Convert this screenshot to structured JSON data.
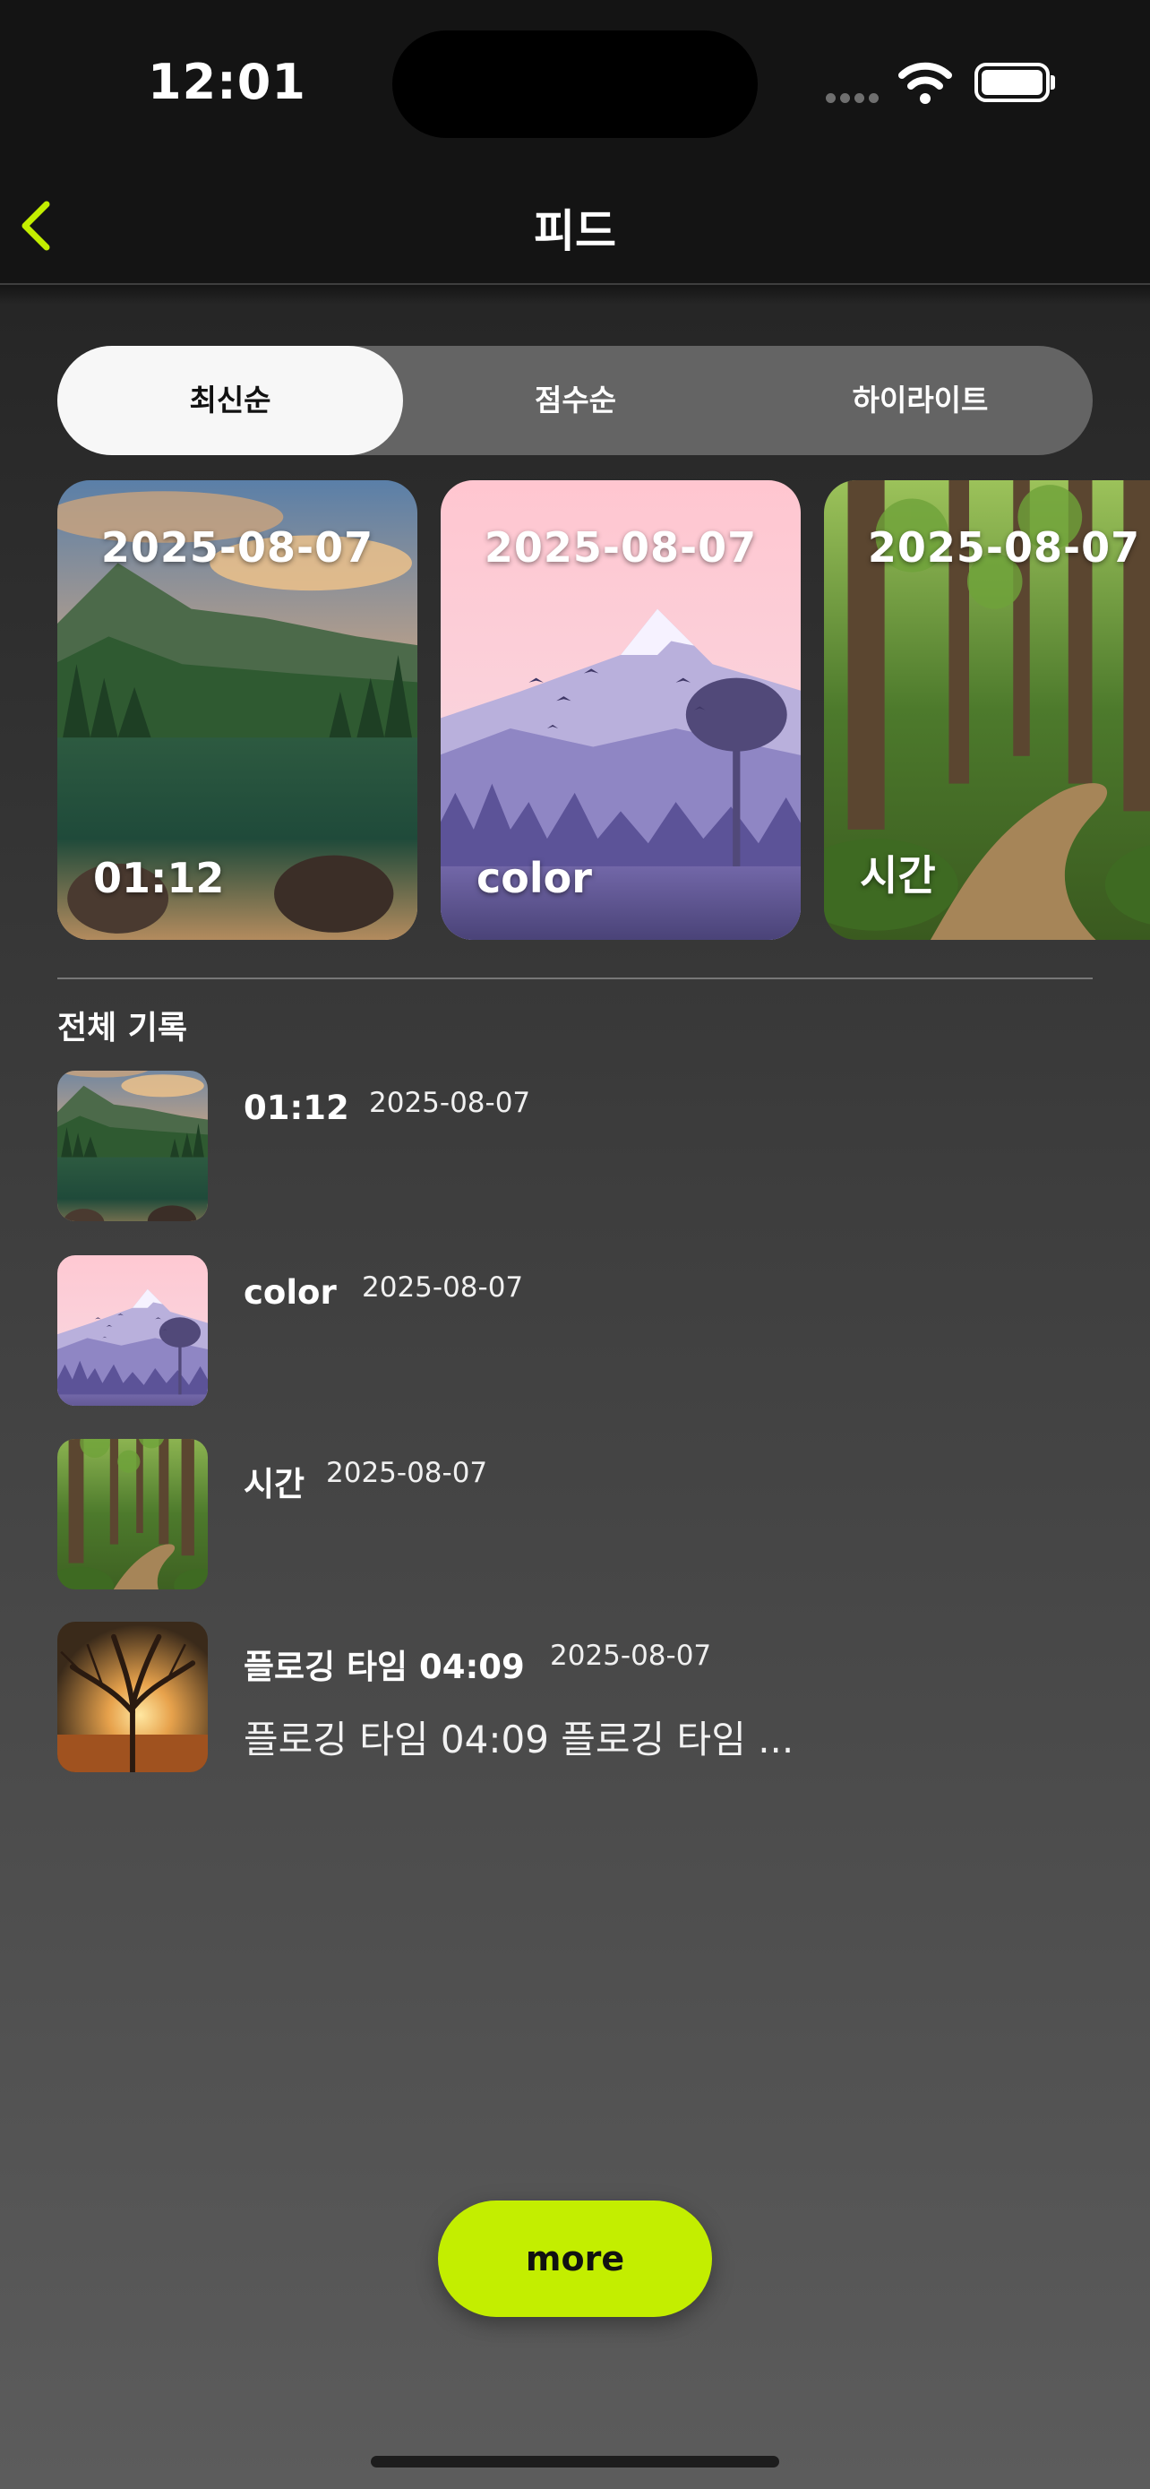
{
  "status_bar": {
    "time": "12:01"
  },
  "nav": {
    "title": "피드",
    "accent_color": "#c3ee00"
  },
  "segments": [
    {
      "label": "최신순",
      "active": true
    },
    {
      "label": "점수순",
      "active": false
    },
    {
      "label": "하이라이트",
      "active": false
    }
  ],
  "cards": [
    {
      "date": "2025-08-07",
      "label": "01:12",
      "image": "mountain-lake"
    },
    {
      "date": "2025-08-07",
      "label": "color",
      "image": "pastel-mountain"
    },
    {
      "date": "2025-08-07",
      "label": "시간",
      "image": "forest-path"
    }
  ],
  "section": {
    "title": "전체 기록"
  },
  "records": [
    {
      "title": "01:12",
      "date": "2025-08-07",
      "body": "",
      "image": "mountain-lake"
    },
    {
      "title": "color",
      "date": "2025-08-07",
      "body": "",
      "image": "pastel-mountain"
    },
    {
      "title": "시간",
      "date": "2025-08-07",
      "body": "",
      "image": "forest-path"
    },
    {
      "title": "플로깅 타임 04:09",
      "date": "2025-08-07",
      "body": "플로깅 타임 04:09 플로깅 타임 ...",
      "image": "sunset-tree"
    }
  ],
  "more_button": {
    "label": "more",
    "color": "#c3ee00"
  }
}
